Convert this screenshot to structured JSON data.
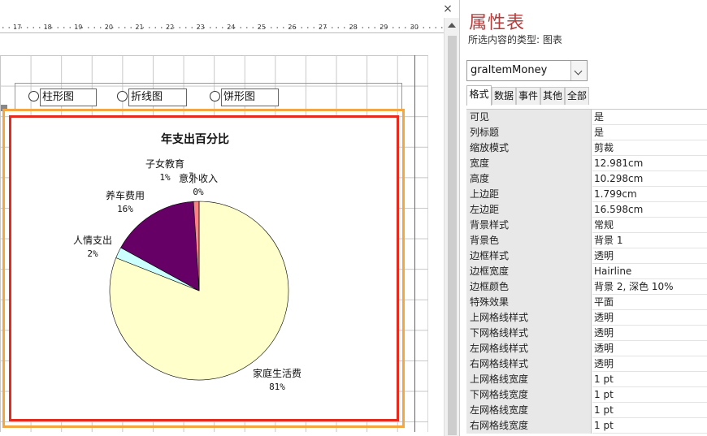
{
  "designer": {
    "close_glyph": "×",
    "ruler_ticks": [
      "17",
      "18",
      "19",
      "20",
      "21",
      "22",
      "23",
      "24",
      "25",
      "26",
      "27",
      "28",
      "29",
      "30"
    ],
    "options": [
      {
        "label": "柱形图"
      },
      {
        "label": "折线图"
      },
      {
        "label": "饼形图"
      }
    ]
  },
  "chart_data": {
    "type": "pie",
    "title": "年支出百分比",
    "slices": [
      {
        "name": "家庭生活费",
        "percent_label": "81%",
        "value": 81,
        "color": "#ffffcc"
      },
      {
        "name": "人情支出",
        "percent_label": "2%",
        "value": 2,
        "color": "#ccffff"
      },
      {
        "name": "养车费用",
        "percent_label": "16%",
        "value": 16,
        "color": "#660066"
      },
      {
        "name": "子女教育",
        "percent_label": "1%",
        "value": 1,
        "color": "#ff8080"
      },
      {
        "name": "意外收入",
        "percent_label": "0%",
        "value": 0,
        "color": "#8080ff"
      }
    ]
  },
  "props": {
    "title": "属性表",
    "selection_type": "所选内容的类型: 图表",
    "object_name": "graItemMoney",
    "tabs": [
      {
        "label": "格式",
        "active": true
      },
      {
        "label": "数据",
        "active": false
      },
      {
        "label": "事件",
        "active": false
      },
      {
        "label": "其他",
        "active": false
      },
      {
        "label": "全部",
        "active": false
      }
    ],
    "rows": [
      {
        "key": "可见",
        "value": "是"
      },
      {
        "key": "列标题",
        "value": "是"
      },
      {
        "key": "缩放模式",
        "value": "剪裁"
      },
      {
        "key": "宽度",
        "value": "12.981cm"
      },
      {
        "key": "高度",
        "value": "10.298cm"
      },
      {
        "key": "上边距",
        "value": "1.799cm"
      },
      {
        "key": "左边距",
        "value": "16.598cm"
      },
      {
        "key": "背景样式",
        "value": "常规"
      },
      {
        "key": "背景色",
        "value": "背景 1"
      },
      {
        "key": "边框样式",
        "value": "透明"
      },
      {
        "key": "边框宽度",
        "value": "Hairline"
      },
      {
        "key": "边框颜色",
        "value": "背景 2, 深色 10%"
      },
      {
        "key": "特殊效果",
        "value": "平面"
      },
      {
        "key": "上网格线样式",
        "value": "透明"
      },
      {
        "key": "下网格线样式",
        "value": "透明"
      },
      {
        "key": "左网格线样式",
        "value": "透明"
      },
      {
        "key": "右网格线样式",
        "value": "透明"
      },
      {
        "key": "上网格线宽度",
        "value": "1 pt"
      },
      {
        "key": "下网格线宽度",
        "value": "1 pt"
      },
      {
        "key": "左网格线宽度",
        "value": "1 pt"
      },
      {
        "key": "右网格线宽度",
        "value": "1 pt"
      }
    ]
  }
}
